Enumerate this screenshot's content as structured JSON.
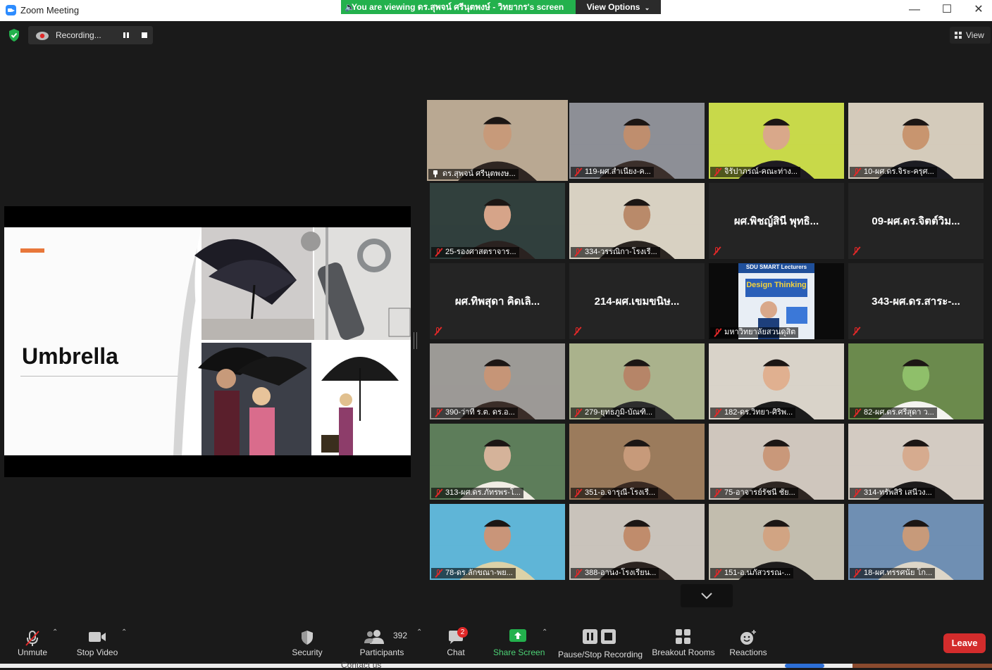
{
  "window": {
    "title": "Zoom Meeting",
    "controls": {
      "minimize": "—",
      "maximize": "☐",
      "close": "✕"
    }
  },
  "share_banner": {
    "text": "You are viewing ดร.สุพจน์ ศรีนุตพงษ์ - วิทยากร's screen",
    "view_options": "View Options"
  },
  "recording": {
    "status_text": "Recording..."
  },
  "view_button": {
    "label": "View"
  },
  "shared_slide": {
    "title": "Umbrella"
  },
  "participants_grid": [
    {
      "name": "ดร.สุพจน์ ศรีนุตพงษ...",
      "muted": false,
      "active_speaker": true,
      "pinned": true
    },
    {
      "name": "119-ผศ.สำเนียง-ค...",
      "muted": true
    },
    {
      "name": "จิรัปาภรณ์-คณะท่าง...",
      "muted": true
    },
    {
      "name": "10-ผศ.ดร.จิระ-ครุศ...",
      "muted": true
    },
    {
      "name": "25-รองศาสตราจาร...",
      "muted": true
    },
    {
      "name": "334-วรรณิกา-โรงเรี...",
      "muted": true
    },
    {
      "name": "ผศ.พิชญ์สินี พุทธิ...",
      "muted": true,
      "video_off": true
    },
    {
      "name": "09-ผศ.ดร.จิตต์วิม...",
      "muted": true,
      "video_off": true
    },
    {
      "name": "ผศ.ทิพสุดา คิดเลิ...",
      "muted": true,
      "video_off": true
    },
    {
      "name": "214-ผศ.เขมขนิษ...",
      "muted": true,
      "video_off": true
    },
    {
      "name": "มหาวิทยาลัยสวนดุสิต",
      "muted": true,
      "poster_text": "SDU SMART Lecturers",
      "poster_headline": "Design Thinking"
    },
    {
      "name": "343-ผศ.ดร.สาระ-...",
      "muted": true,
      "video_off": true
    },
    {
      "name": "390-ว่าที่ ร.ต. ดร.อ...",
      "muted": true
    },
    {
      "name": "279-ยุทธภูมิ-บัณฑิ...",
      "muted": true
    },
    {
      "name": "182-ดร.วิทยา-ศิริพ...",
      "muted": true
    },
    {
      "name": "82-ผศ.ดร.ศรีสุดา ว...",
      "muted": true
    },
    {
      "name": "313-ผศ.ดร.ภัทรพร-โ...",
      "muted": true
    },
    {
      "name": "351-อ.จารุณี-โรงเรี...",
      "muted": true
    },
    {
      "name": "75-อาจารย์รัชนี ชัย...",
      "muted": true
    },
    {
      "name": "314-ทรัพสิริ เสนีวง...",
      "muted": true
    },
    {
      "name": "78-ดร.ลักขณา-พย...",
      "muted": true
    },
    {
      "name": "388-อานง-โรงเรียน...",
      "muted": true
    },
    {
      "name": "151-อ.นภัสวรรณ-...",
      "muted": true
    },
    {
      "name": "18-ผศ.ทรรศนัย โก...",
      "muted": true
    }
  ],
  "toolbar": {
    "unmute": "Unmute",
    "stop_video": "Stop Video",
    "security": "Security",
    "participants": "Participants",
    "participants_count": "392",
    "chat": "Chat",
    "chat_badge": "2",
    "share_screen": "Share Screen",
    "pause_stop_recording": "Pause/Stop Recording",
    "breakout_rooms": "Breakout Rooms",
    "reactions": "Reactions",
    "leave": "Leave"
  },
  "background_text": {
    "contact": "Contact us"
  },
  "colors": {
    "banner_green": "#23b14d",
    "active_speaker_border": "#c6e33a",
    "leave_red": "#d32c2c",
    "share_green": "#23b14d",
    "mute_red": "#e02828",
    "slide_accent": "#e8773a"
  },
  "icons": {
    "app": "zoom-logo-icon",
    "security": "shield-icon",
    "recording": "cloud-record-icon",
    "grid_view": "grid-icon",
    "mic": "mic-muted-icon",
    "video": "video-camera-icon",
    "participants": "people-icon",
    "chat": "chat-bubble-icon",
    "share": "share-arrow-icon",
    "breakout": "grid-squares-icon",
    "reactions": "smiley-plus-icon"
  }
}
